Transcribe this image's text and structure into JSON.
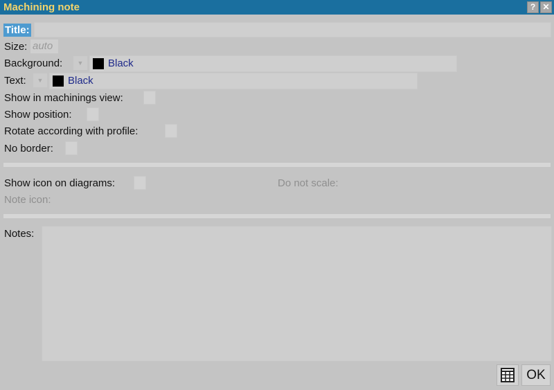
{
  "window": {
    "title": "Machining note",
    "help_button": "?",
    "close_button": "✕"
  },
  "form": {
    "title_label": "Title:",
    "title_value": "",
    "size_label": "Size:",
    "size_placeholder": "auto",
    "background_label": "Background:",
    "background_color_name": "Black",
    "background_color": "#000000",
    "text_label": "Text:",
    "text_color_name": "Black",
    "text_color": "#000000",
    "show_in_machinings_view_label": "Show in machinings view:",
    "show_position_label": "Show position:",
    "rotate_label": "Rotate according with profile:",
    "no_border_label": "No border:"
  },
  "icon_section": {
    "show_icon_label": "Show icon on diagrams:",
    "do_not_scale_label": "Do not scale:",
    "note_icon_label": "Note icon:"
  },
  "notes": {
    "label": "Notes:",
    "value": ""
  },
  "footer": {
    "ok_label": "OK",
    "grid_icon": "table-icon"
  },
  "colors": {
    "titlebar": "#1a6f9f",
    "title_text": "#f3d46b",
    "background": "#c4c4c4",
    "selected_label": "#4e9bd0",
    "color_name": "#1f2a8a"
  }
}
